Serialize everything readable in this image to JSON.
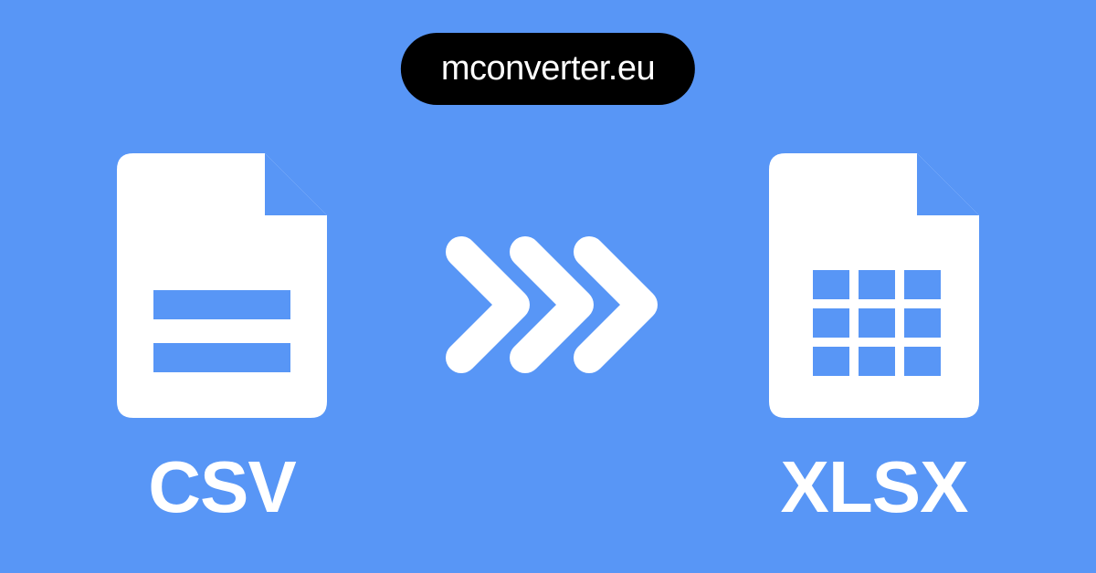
{
  "brand": "mconverter.eu",
  "source": {
    "format_label": "CSV",
    "icon_name": "csv-file-icon"
  },
  "target": {
    "format_label": "XLSX",
    "icon_name": "xlsx-file-icon"
  },
  "colors": {
    "background": "#5896f6",
    "icon_fill": "#ffffff",
    "badge_bg": "#000000",
    "badge_text": "#ffffff"
  }
}
